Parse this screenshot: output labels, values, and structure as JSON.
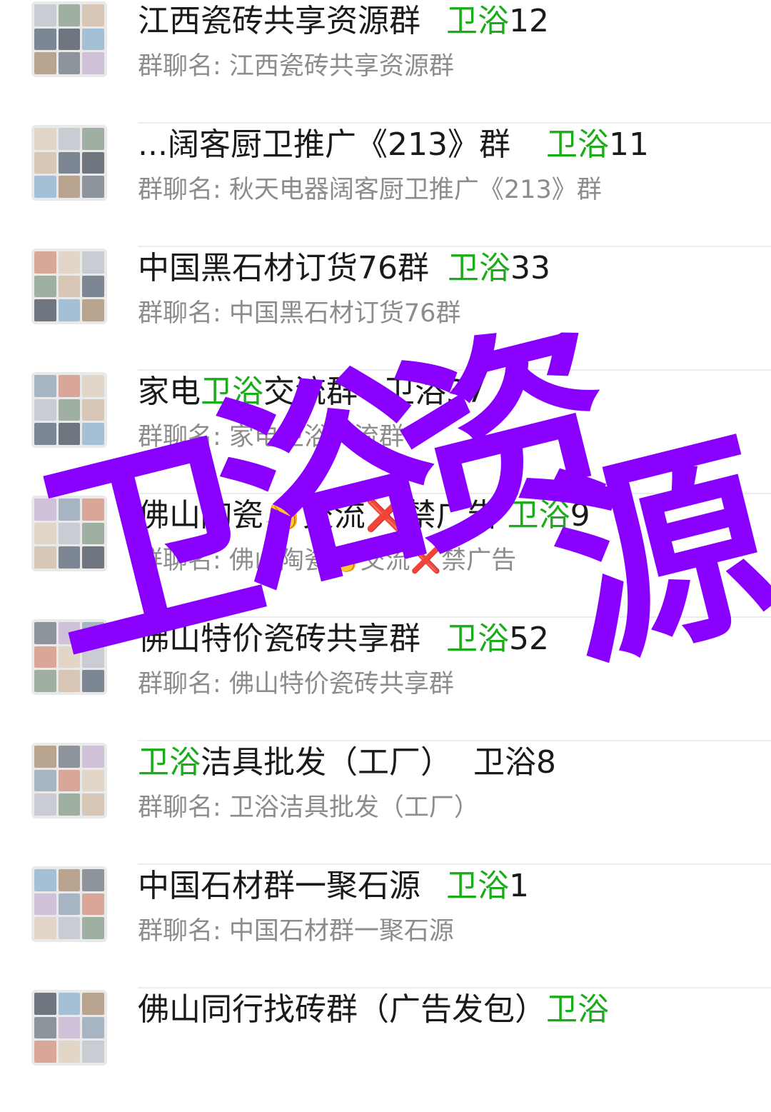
{
  "colors": {
    "accent_green": "#1aad19",
    "watermark_purple": "#8a00ff"
  },
  "chats": [
    {
      "title": "江西瓷砖共享资源群",
      "tag": "卫浴",
      "num": "12",
      "subtitle": "群聊名: 江西瓷砖共享资源群"
    },
    {
      "title": "...阔客厨卫推广《213》群",
      "tag": "卫浴",
      "num": "11",
      "subtitle": "群聊名: 秋天电器阔客厨卫推广《213》群"
    },
    {
      "title": "中国黑石材订货76群",
      "tag": "卫浴",
      "num": "33",
      "subtitle": "群聊名: 中国黑石材订货76群"
    },
    {
      "title_pre": "家电",
      "title_hl": "卫浴",
      "title_post": "交流群",
      "suffix": "卫浴37",
      "subtitle": "群聊名: 家电卫浴交流群"
    },
    {
      "title": "佛山陶瓷👏交流❌禁广告",
      "tag": "卫浴",
      "num": "9",
      "subtitle": "群聊名: 佛山陶瓷👏交流❌禁广告"
    },
    {
      "title": "佛山特价瓷砖共享群",
      "tag": "卫浴",
      "num": "52",
      "subtitle": "群聊名: 佛山特价瓷砖共享群"
    },
    {
      "title_hl": "卫浴",
      "title_post": "洁具批发（工厂）",
      "suffix": "卫浴8",
      "subtitle": "群聊名: 卫浴洁具批发（工厂）"
    },
    {
      "title": "中国石材群一聚石源",
      "tag": "卫浴",
      "num": "1",
      "subtitle": "群聊名: 中国石材群一聚石源"
    },
    {
      "title": "佛山同行找砖群（广告发包）",
      "tag": "卫浴"
    }
  ],
  "watermark": {
    "chars": [
      "卫",
      "浴",
      "资",
      "源"
    ]
  }
}
